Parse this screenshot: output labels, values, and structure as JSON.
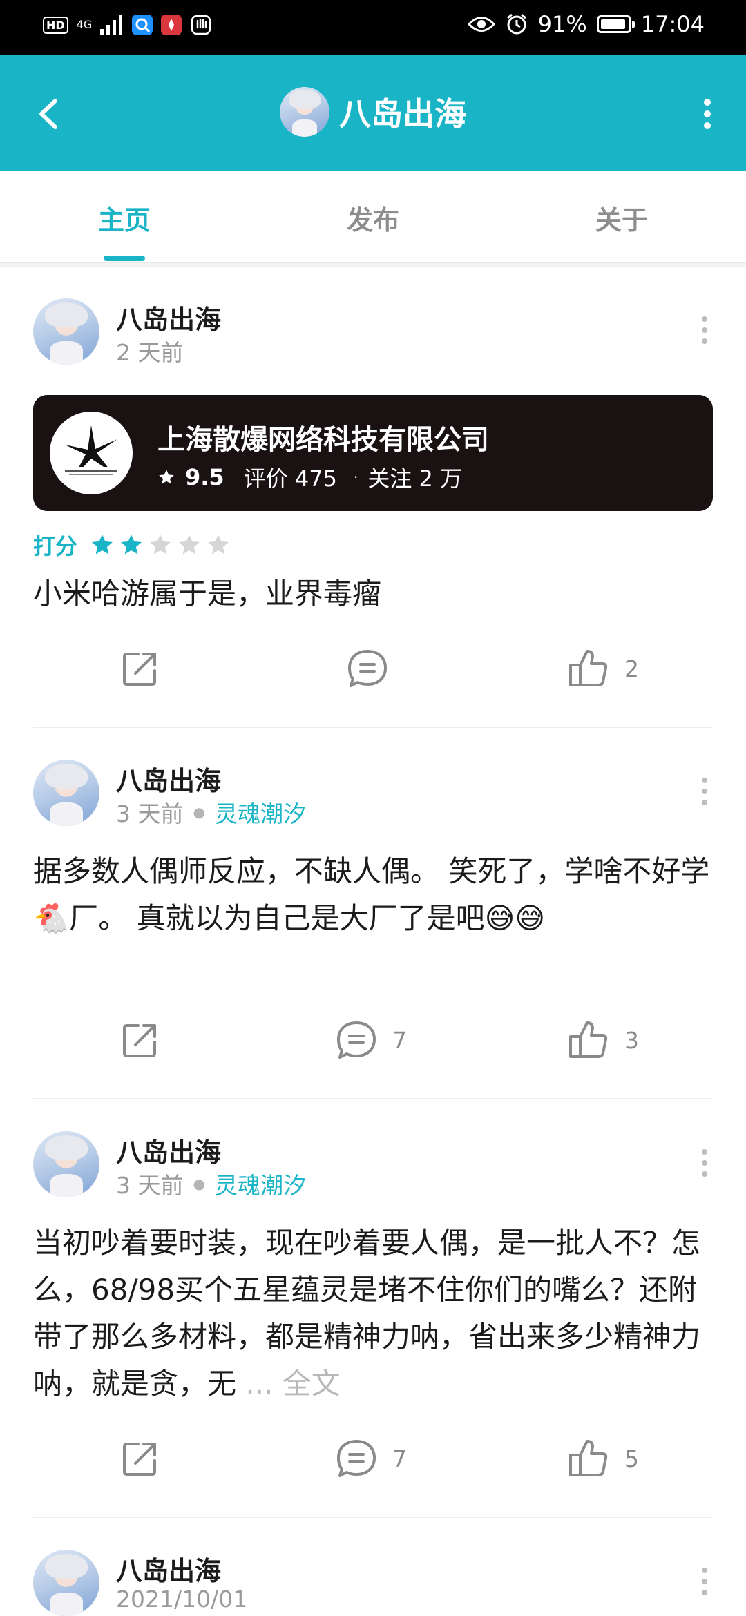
{
  "status_bar": {
    "left_badge": "HD",
    "network": "4G",
    "battery_percent": "91%",
    "battery_level": 0.91,
    "time": "17:04"
  },
  "app_bar": {
    "title": "八岛出海",
    "back_icon": "arrow-left-icon",
    "more_icon": "more-vertical-icon"
  },
  "tabs": [
    {
      "label": "主页",
      "active": true
    },
    {
      "label": "发布",
      "active": false
    },
    {
      "label": "关于",
      "active": false
    }
  ],
  "posts": [
    {
      "author": "八岛出海",
      "time": "2 天前",
      "company": {
        "name": "上海散爆网络科技有限公司",
        "score": "9.5",
        "reviews": "评价 475",
        "followers": "关注 2 万"
      },
      "rating": {
        "label": "打分",
        "stars": 2,
        "max": 5
      },
      "text": "小米哈游属于是，业界毒瘤",
      "comments": "",
      "likes": "2"
    },
    {
      "author": "八岛出海",
      "time": "3 天前",
      "game": "灵魂潮汐",
      "text": "据多数人偶师反应，不缺人偶。 笑死了，学啥不好学🐔厂。 真就以为自己是大厂了是吧😅😅",
      "comments": "7",
      "likes": "3"
    },
    {
      "author": "八岛出海",
      "time": "3 天前",
      "game": "灵魂潮汐",
      "text": "当初吵着要时装，现在吵着要人偶，是一批人不？怎么，68/98买个五星蕴灵是堵不住你们的嘴么？还附带了那么多材料，都是精神力呐，省出来多少精神力呐，就是贪，无",
      "ellipsis": "...",
      "full_text_label": "全文",
      "comments": "7",
      "likes": "5"
    },
    {
      "author": "八岛出海",
      "time": "2021/10/01"
    }
  ],
  "colors": {
    "accent": "#19b5c6",
    "status_bar": "#000000",
    "card_bg": "#1a1212",
    "muted_text": "#9a9a9a"
  }
}
